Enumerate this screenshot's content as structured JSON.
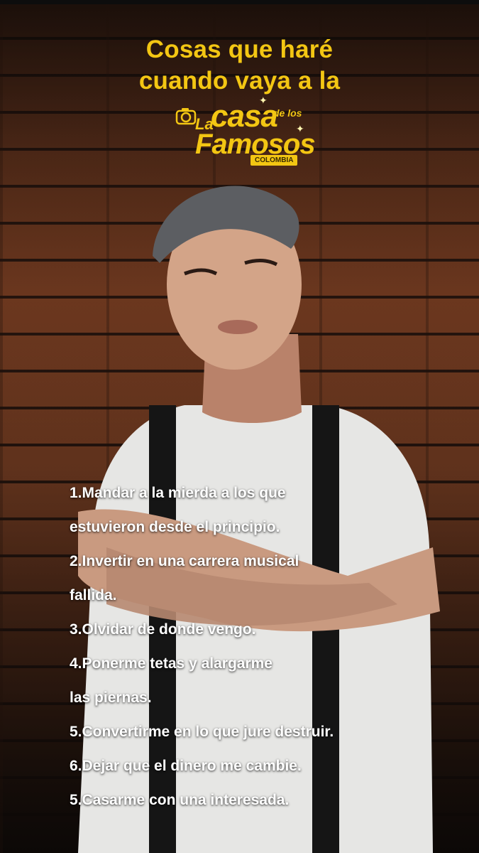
{
  "title": {
    "line1": "Cosas que haré",
    "line2": "cuando vaya a la"
  },
  "logo": {
    "la": "La",
    "casa": "casa",
    "de_los": "de los",
    "famosos": "Famosos",
    "country": "COLOMBIA",
    "icon": "camera-icon"
  },
  "items": [
    "1.Mandar a la mierda a los que",
    "estuvieron desde el principio.",
    "2.Invertir en una carrera musical",
    "fallida.",
    "3.Olvidar de donde vengo.",
    "4.Ponerme tetas y alargarme",
    "las piernas.",
    "5.Convertirme en lo que jure destruir.",
    "6.Dejar que el dinero me cambie.",
    "5.Casarme con una interesada."
  ],
  "colors": {
    "accent": "#f3c613",
    "text": "#ffffff",
    "brick": "#7a3e22"
  }
}
